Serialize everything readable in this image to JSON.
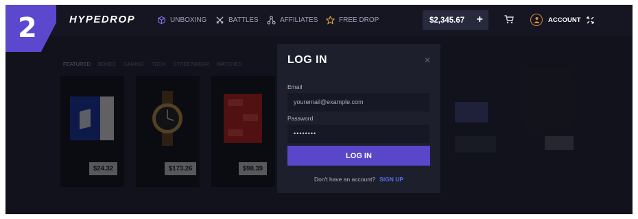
{
  "step_number": "2",
  "header": {
    "logo": "HYPEDROP",
    "nav": [
      {
        "label": "UNBOXING",
        "icon": "box-icon"
      },
      {
        "label": "BATTLES",
        "icon": "crossed-swords-icon"
      },
      {
        "label": "AFFILIATES",
        "icon": "network-icon"
      },
      {
        "label": "FREE DROP",
        "icon": "star-icon"
      }
    ],
    "balance": "$2,345.67",
    "balance_add": "+",
    "account_label": "ACCOUNT"
  },
  "background": {
    "tabs": [
      "FEATURED",
      "BOXES",
      "GAMING",
      "TECH",
      "STREETWEAR",
      "WATCHES"
    ],
    "cards": [
      {
        "price": "$24.32",
        "icon": "console-box-icon"
      },
      {
        "price": "$173.26",
        "icon": "watch-icon"
      },
      {
        "price": "$98.39",
        "icon": "red-box-icon"
      }
    ]
  },
  "modal": {
    "title": "LOG IN",
    "close": "✕",
    "email_label": "Email",
    "email_placeholder": "youremail@example.com",
    "password_label": "Password",
    "password_value": "••••••••",
    "submit_label": "LOG IN",
    "signup_prompt": "Don't have an account?",
    "signup_link": "SIGN UP"
  },
  "colors": {
    "accent": "#5946c9",
    "link": "#5b6cf0",
    "background": "#11121c"
  }
}
